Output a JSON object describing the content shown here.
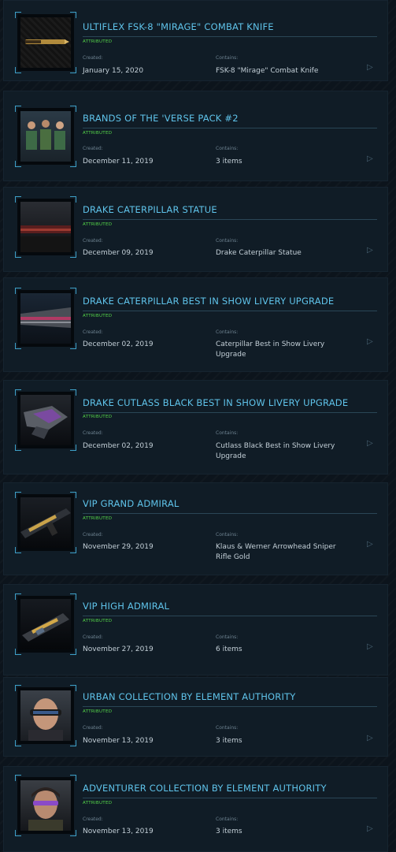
{
  "labels": {
    "created": "Created:",
    "contains": "Contains:"
  },
  "items": [
    {
      "title": "ULTIFLEX FSK-8 \"MIRAGE\" COMBAT KNIFE",
      "status": "ATTRIBUTED",
      "created": "January 15, 2020",
      "contains": "FSK-8 \"Mirage\" Combat Knife"
    },
    {
      "title": "BRANDS OF THE 'VERSE PACK #2",
      "status": "ATTRIBUTED",
      "created": "December 11, 2019",
      "contains": "3 items"
    },
    {
      "title": "DRAKE CATERPILLAR STATUE",
      "status": "ATTRIBUTED",
      "created": "December 09, 2019",
      "contains": "Drake Caterpillar Statue"
    },
    {
      "title": "DRAKE CATERPILLAR BEST IN SHOW LIVERY UPGRADE",
      "status": "ATTRIBUTED",
      "created": "December 02, 2019",
      "contains": "Caterpillar Best in Show Livery Upgrade"
    },
    {
      "title": "DRAKE CUTLASS BLACK BEST IN SHOW LIVERY UPGRADE",
      "status": "ATTRIBUTED",
      "created": "December 02, 2019",
      "contains": "Cutlass Black Best in Show Livery Upgrade"
    },
    {
      "title": "VIP GRAND ADMIRAL",
      "status": "ATTRIBUTED",
      "created": "November 29, 2019",
      "contains": "Klaus & Werner Arrowhead Sniper Rifle Gold"
    },
    {
      "title": "VIP HIGH ADMIRAL",
      "status": "ATTRIBUTED",
      "created": "November 27, 2019",
      "contains": "6 items"
    },
    {
      "title": "URBAN COLLECTION BY ELEMENT AUTHORITY",
      "status": "ATTRIBUTED",
      "created": "November 13, 2019",
      "contains": "3 items"
    },
    {
      "title": "ADVENTURER COLLECTION BY ELEMENT AUTHORITY",
      "status": "ATTRIBUTED",
      "created": "November 13, 2019",
      "contains": "3 items"
    }
  ]
}
